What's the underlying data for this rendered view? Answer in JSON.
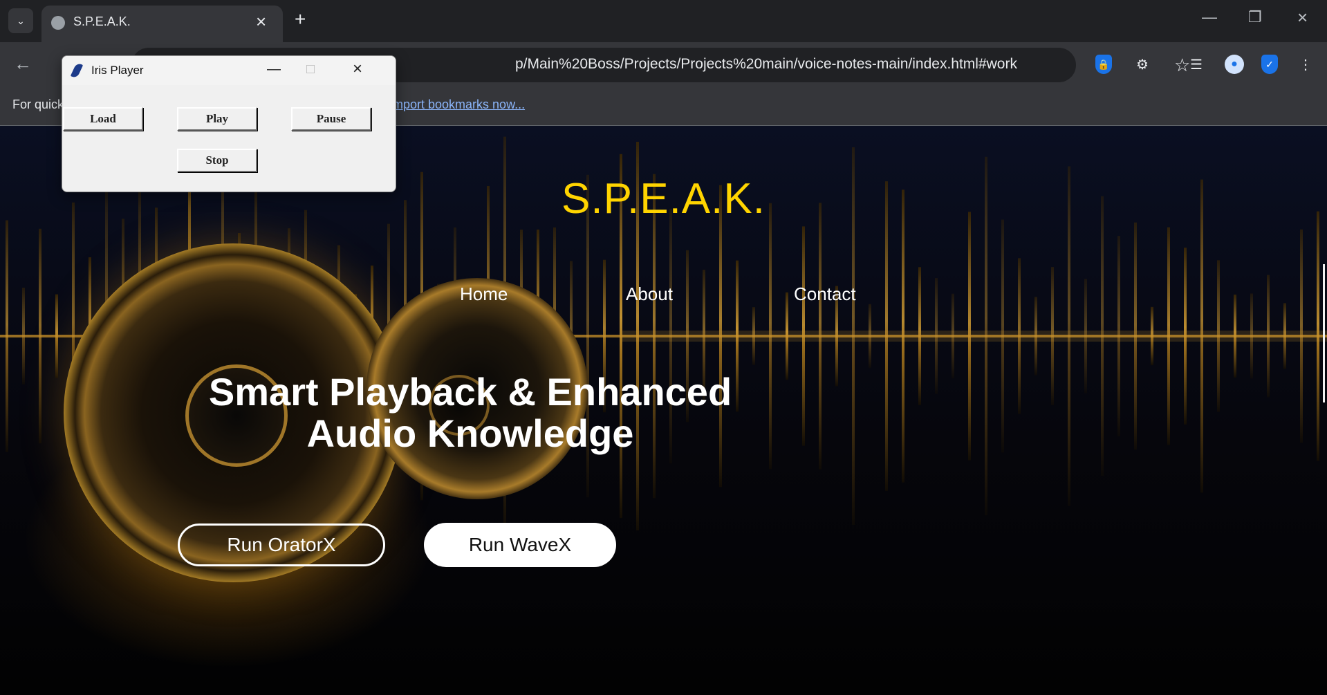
{
  "browser": {
    "tab_title": "S.P.E.A.K.",
    "url": "p/Main%20Boss/Projects/Projects%20main/voice-notes-main/index.html#work",
    "bookmarks_prefix": "For quick",
    "bookmarks_link": "mport bookmarks now..."
  },
  "iris_player": {
    "title": "Iris Player",
    "buttons": {
      "load": "Load",
      "play": "Play",
      "pause": "Pause",
      "stop": "Stop"
    }
  },
  "site": {
    "title": "S.P.E.A.K.",
    "nav": [
      "Home",
      "About",
      "Contact"
    ],
    "hero_line1": "Smart Playback & Enhanced",
    "hero_line2": "Audio Knowledge",
    "btn_oratorx": "Run OratorX",
    "btn_wavex": "Run WaveX"
  },
  "colors": {
    "title_yellow": "#ffd400",
    "chrome_dark": "#202124",
    "chrome_mid": "#35363a",
    "link_blue": "#8ab4f8",
    "gold": "#c4942c"
  },
  "icons": [
    "tab-search-icon",
    "globe-icon",
    "close-icon",
    "plus-icon",
    "minimize-icon",
    "restore-icon",
    "back-arrow-icon",
    "star-icon",
    "password-lock-icon",
    "extensions-icon",
    "media-queue-icon",
    "profile-icon",
    "shield-check-icon",
    "more-vert-icon",
    "feather-icon"
  ]
}
